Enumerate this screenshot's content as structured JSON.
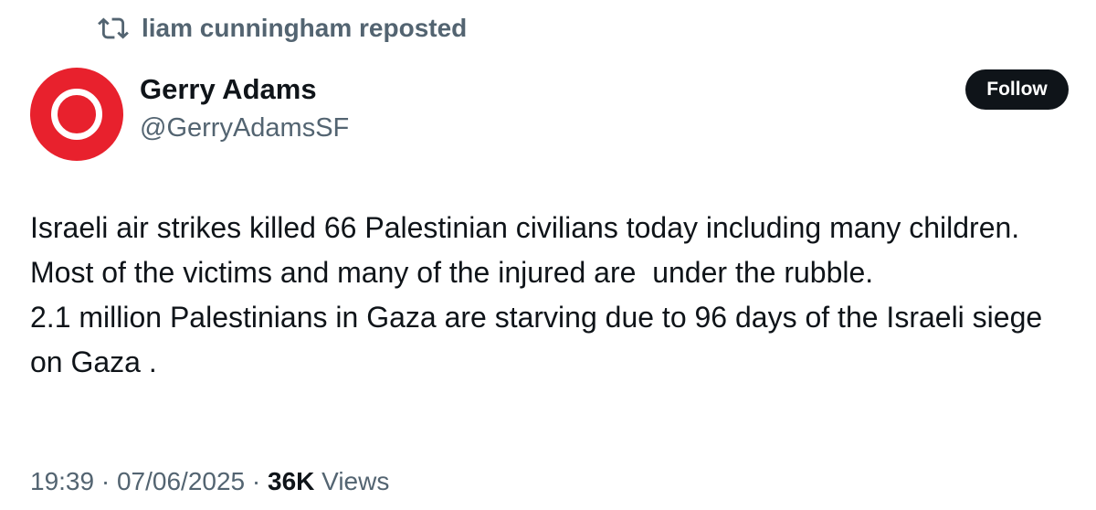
{
  "repost": {
    "icon": "repost-icon",
    "text": "liam cunningham reposted"
  },
  "author": {
    "name": "Gerry Adams",
    "handle": "@GerryAdamsSF",
    "avatar_color": "#e8212d"
  },
  "follow_label": "Follow",
  "body": {
    "paragraph_1": "Israeli air strikes killed 66 Palestinian civilians today including many children. Most of the victims and many of the injured are  under the rubble.",
    "paragraph_2": "2.1 million Palestinians in Gaza are starving due to 96 days of the Israeli siege on Gaza ."
  },
  "meta": {
    "time": "19:39",
    "separator": " · ",
    "date": "07/06/2025",
    "views_count": "36K",
    "views_label": "Views"
  },
  "colors": {
    "text": "#0f1419",
    "secondary": "#536471",
    "button_bg": "#0f1419"
  }
}
